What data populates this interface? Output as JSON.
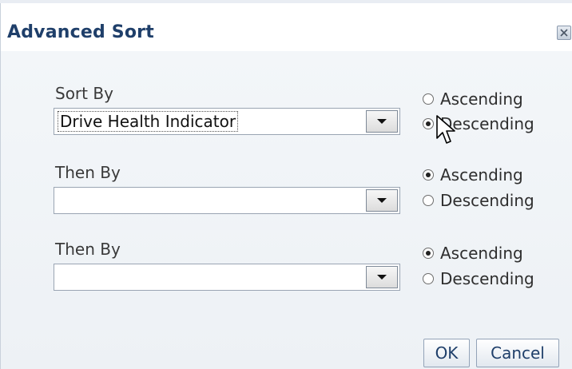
{
  "dialog": {
    "title": "Advanced Sort",
    "close_icon": "close-icon"
  },
  "sort_rows": [
    {
      "label": "Sort By",
      "selected_value": "Drive Health Indicator",
      "ascending_label": "Ascending",
      "descending_label": "Descending",
      "order": "descending"
    },
    {
      "label": "Then By",
      "selected_value": "",
      "ascending_label": "Ascending",
      "descending_label": "Descending",
      "order": "ascending"
    },
    {
      "label": "Then By",
      "selected_value": "",
      "ascending_label": "Ascending",
      "descending_label": "Descending",
      "order": "ascending"
    }
  ],
  "buttons": {
    "ok_label": "OK",
    "cancel_label": "Cancel"
  },
  "colors": {
    "title": "#1f3f6a",
    "button_text": "#1f3f6a"
  }
}
